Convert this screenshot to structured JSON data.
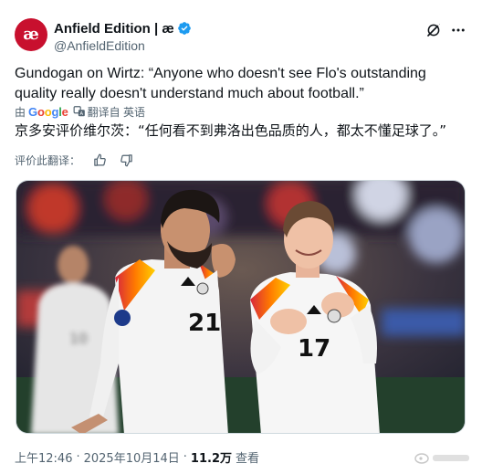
{
  "author": {
    "display_name": "Anfield Edition | æ",
    "handle": "@AnfieldEdition",
    "avatar_text": "æ"
  },
  "tweet": {
    "text": "Gundogan on Wirtz: “Anyone who doesn't see Flo's outstanding quality really doesn't understand much about football.”",
    "translated_by": "由",
    "translator_name": "Google",
    "translate_action": "翻译自 英语",
    "translated_text": "京多安评价维尔茨：“任何看不到弗洛出色品质的人，都太不懂足球了。”",
    "rate_translation": "评价此翻译："
  },
  "media": {
    "jersey_numbers": [
      "21",
      "17"
    ]
  },
  "footer": {
    "time": "上午12:46",
    "separator": "·",
    "date": "2025年10月14日",
    "views_count": "11.2万",
    "views_label": "查看"
  },
  "colors": {
    "brand_red": "#c8102e",
    "verified_blue": "#1d9bf0",
    "text_primary": "#0f1419",
    "text_secondary": "#536471"
  },
  "icons": {
    "verified": "verified-badge-icon",
    "grok": "grok-icon",
    "more": "more-horizontal-icon",
    "translate": "translate-icon",
    "thumbs_up": "thumbs-up-icon",
    "thumbs_down": "thumbs-down-icon"
  }
}
